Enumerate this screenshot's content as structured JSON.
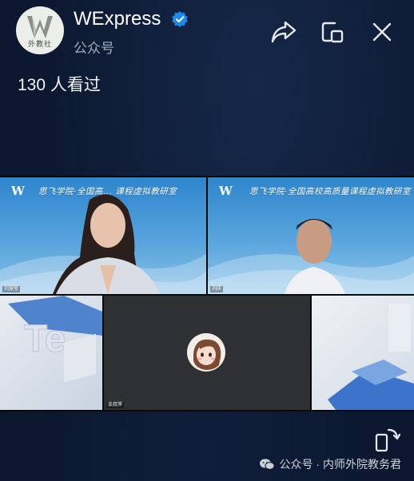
{
  "header": {
    "account_name": "WExpress",
    "account_type": "公众号",
    "logo_text": "外教社",
    "icons": [
      "verified-badge-icon",
      "share-icon",
      "floating-window-icon",
      "close-icon"
    ]
  },
  "view_count": "130 人看过",
  "video_grid": {
    "tiles": [
      {
        "banner": "思飞学院·全国高... 课程虚拟教研室",
        "name_tag": "刘慧莹"
      },
      {
        "banner": "思飞学院·全国高校高质量课程虚拟教研室",
        "name_tag": "刘庆"
      },
      {
        "name_tag": "余叔萍"
      }
    ]
  },
  "footer": {
    "watermark": "公众号 · 内师外院教务君",
    "icons": [
      "rotate-screen-icon",
      "wechat-icon"
    ]
  },
  "colors": {
    "background": "#0c1830",
    "verified": "#1e88e5",
    "banner_blue": "#2e85cd",
    "empty_tile": "#2f3034"
  }
}
